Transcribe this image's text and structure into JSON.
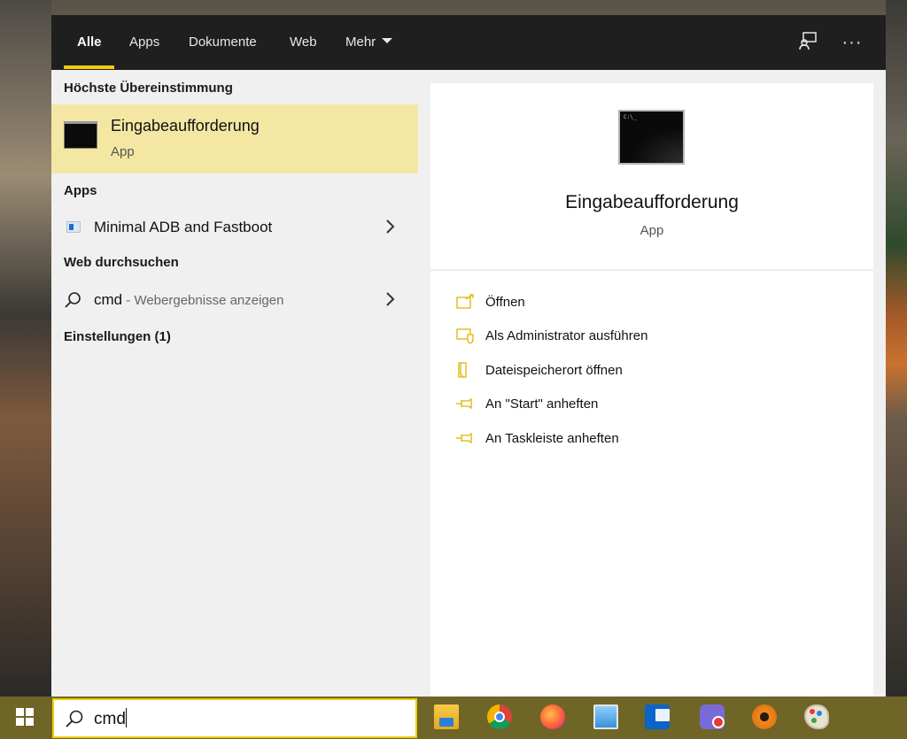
{
  "topbar": {
    "tabs": [
      {
        "label": "Alle",
        "active": true
      },
      {
        "label": "Apps"
      },
      {
        "label": "Dokumente"
      },
      {
        "label": "Web"
      },
      {
        "label": "Mehr"
      }
    ],
    "icons": [
      "feedback-icon",
      "more-options-icon"
    ]
  },
  "results": {
    "best_match_heading": "Höchste Übereinstimmung",
    "best_match": {
      "title": "Eingabeaufforderung",
      "subtitle": "App"
    },
    "apps_heading": "Apps",
    "apps": [
      {
        "label": "Minimal ADB and Fastboot"
      }
    ],
    "web_heading": "Web durchsuchen",
    "web": {
      "query": "cmd",
      "hint": " - Webergebnisse anzeigen"
    },
    "settings_heading": "Einstellungen (1)"
  },
  "preview": {
    "title": "Eingabeaufforderung",
    "subtitle": "App",
    "cmd_prompt": "C:\\_",
    "actions": [
      {
        "label": "Öffnen",
        "icon": "open-icon"
      },
      {
        "label": "Als Administrator ausführen",
        "icon": "admin-shield-icon"
      },
      {
        "label": "Dateispeicherort öffnen",
        "icon": "file-location-icon"
      },
      {
        "label": "An \"Start\" anheften",
        "icon": "pin-icon"
      },
      {
        "label": "An Taskleiste anheften",
        "icon": "pin-icon"
      }
    ]
  },
  "taskbar": {
    "search_value": "cmd",
    "apps": [
      "file-explorer-icon",
      "chrome-icon",
      "firefox-icon",
      "control-panel-icon",
      "outlook-icon",
      "video-call-icon",
      "tor-icon",
      "paint-icon"
    ]
  },
  "colors": {
    "accent": "#f2cc0c",
    "selected_row": "#f3e7a3",
    "topbar": "#1f1f1f",
    "taskbar": "#6f6527"
  }
}
